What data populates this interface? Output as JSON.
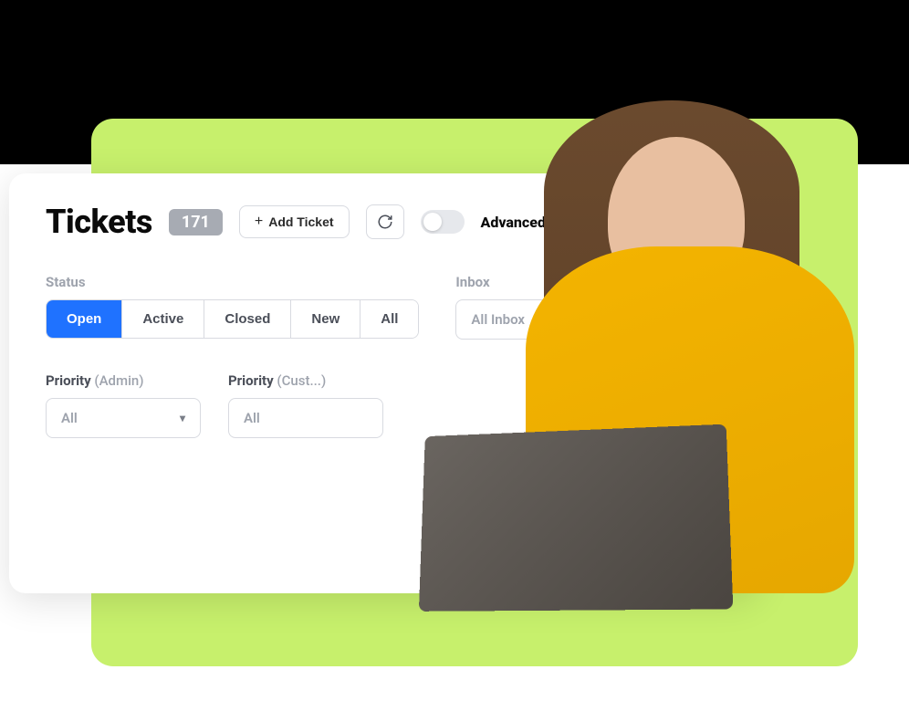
{
  "header": {
    "title": "Tickets",
    "count": "171",
    "add_ticket_label": "Add Ticket",
    "advanced_filter_label": "Advanced Filter"
  },
  "status": {
    "label": "Status",
    "options": [
      "Open",
      "Active",
      "Closed",
      "New",
      "All"
    ],
    "active_index": 0
  },
  "inbox": {
    "label": "Inbox",
    "placeholder": "All Inbox"
  },
  "priority_admin": {
    "label": "Priority",
    "sublabel": "(Admin)",
    "value": "All"
  },
  "priority_customer": {
    "label": "Priority",
    "sublabel": "(Cust...)",
    "value": "All"
  },
  "colors": {
    "accent_green": "#c7f06c",
    "accent_blue": "#1f72ff",
    "badge_gray": "#a7abb3"
  }
}
